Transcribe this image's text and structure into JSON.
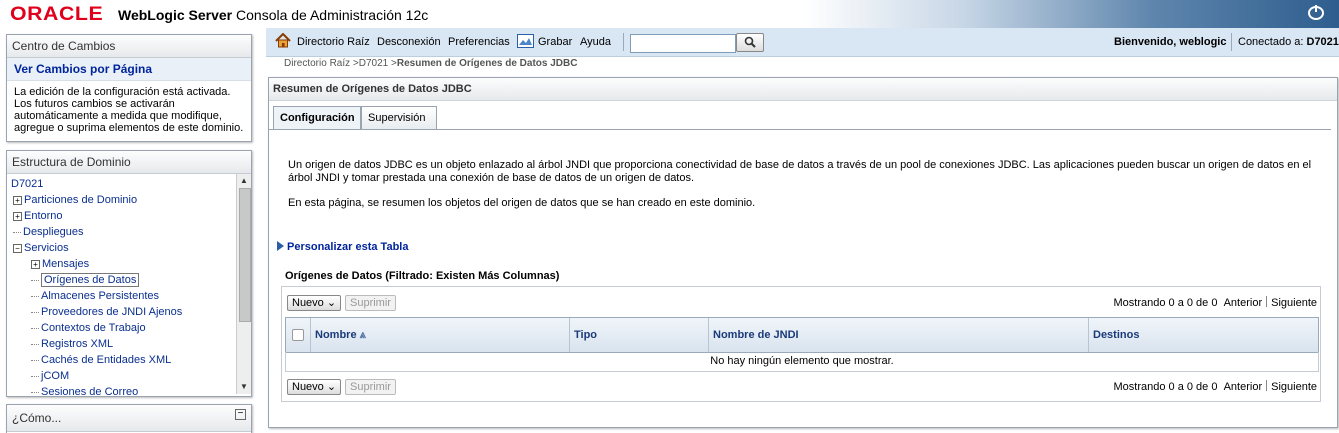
{
  "brand": {
    "oracle": "ORACLE",
    "product_bold": "WebLogic Server",
    "product_rest": "Consola de Administración 12c"
  },
  "change_center": {
    "title": "Centro de Cambios",
    "link": "Ver Cambios por Página",
    "text": "La edición de la configuración está activada. Los futuros cambios se activarán automáticamente a medida que modifique, agregue o suprima elementos de este dominio."
  },
  "domain_structure": {
    "title": "Estructura de Dominio",
    "root": "D7021",
    "items": [
      {
        "label": "Particiones de Dominio",
        "level": 1,
        "expand": "+"
      },
      {
        "label": "Entorno",
        "level": 1,
        "expand": "+"
      },
      {
        "label": "Despliegues",
        "level": 1,
        "expand": ""
      },
      {
        "label": "Servicios",
        "level": 1,
        "expand": "−"
      },
      {
        "label": "Mensajes",
        "level": 2,
        "expand": "+"
      },
      {
        "label": "Orígenes de Datos",
        "level": 2,
        "expand": "",
        "selected": true
      },
      {
        "label": "Almacenes Persistentes",
        "level": 2,
        "expand": ""
      },
      {
        "label": "Proveedores de JNDI Ajenos",
        "level": 2,
        "expand": ""
      },
      {
        "label": "Contextos de Trabajo",
        "level": 2,
        "expand": ""
      },
      {
        "label": "Registros XML",
        "level": 2,
        "expand": ""
      },
      {
        "label": "Cachés de Entidades XML",
        "level": 2,
        "expand": ""
      },
      {
        "label": "jCOM",
        "level": 2,
        "expand": ""
      },
      {
        "label": "Sesiones de Correo",
        "level": 2,
        "expand": ""
      }
    ]
  },
  "how_to": {
    "title": "¿Cómo..."
  },
  "topnav": {
    "home": "Directorio Raíz",
    "logout": "Desconexión",
    "prefs": "Preferencias",
    "record": "Grabar",
    "help": "Ayuda",
    "search_value": "",
    "welcome": "Bienvenido, weblogic",
    "connected_prefix": "Conectado a:",
    "connected_domain": "D7021"
  },
  "breadcrumb": {
    "home": "Directorio Raíz",
    "domain": "D7021",
    "current": "Resumen de Orígenes de Datos JDBC"
  },
  "page": {
    "title": "Resumen de Orígenes de Datos JDBC",
    "tabs": [
      "Configuración",
      "Supervisión"
    ],
    "desc1": "Un origen de datos JDBC es un objeto enlazado al árbol JNDI que proporciona conectividad de base de datos a través de un pool de conexiones JDBC. Las aplicaciones pueden buscar un origen de datos en el árbol JNDI y tomar prestada una conexión de base de datos de un origen de datos.",
    "desc2": "En esta página, se resumen los objetos del origen de datos que se han creado en este dominio.",
    "customize": "Personalizar esta Tabla",
    "table_title": "Orígenes de Datos (Filtrado: Existen Más Columnas)",
    "new_btn": "Nuevo",
    "delete_btn": "Suprimir",
    "paging_text": "Mostrando 0 a 0 de 0",
    "prev": "Anterior",
    "next": "Siguiente",
    "columns": [
      "Nombre",
      "Tipo",
      "Nombre de JNDI",
      "Destinos"
    ],
    "empty_message": "No hay ningún elemento que mostrar."
  },
  "colors": {
    "oracle_red": "#e0001b",
    "link_blue": "#00249c",
    "nav_bg": "#d9e6f4"
  }
}
